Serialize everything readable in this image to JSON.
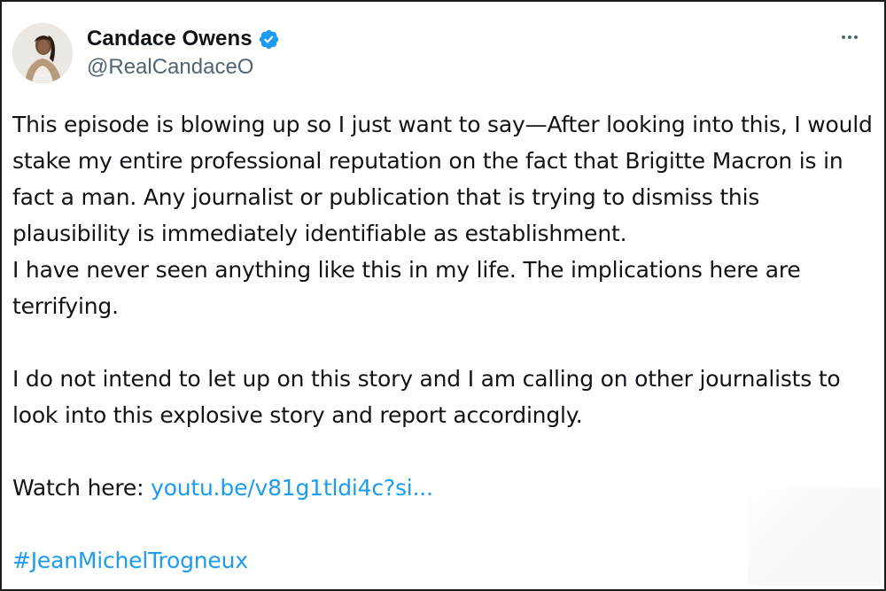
{
  "tweet": {
    "author": {
      "display_name": "Candace Owens",
      "handle": "@RealCandaceO",
      "verified": true
    },
    "more_icon": "more-horizontal-icon",
    "body": {
      "paragraph_1": "This episode is blowing up so I just want to say—After looking into this, I would stake my entire professional reputation on the fact that Brigitte Macron is in fact a man. Any journalist or publication that is trying to dismiss this plausibility is immediately identifiable as establishment.",
      "paragraph_2": "I have never seen anything like this in my life. The implications here are terrifying.",
      "paragraph_3": "I do not intend to let up on this story and I am calling on other journalists to look into this explosive story and report accordingly.",
      "watch_prefix": "Watch here: ",
      "watch_link": "youtu.be/v81g1tldi4c?si...",
      "hashtag": "#JeanMichelTrogneux"
    },
    "colors": {
      "link": "#1d9bf0",
      "verified_badge": "#1d9bf0",
      "text": "#0f1419",
      "secondary_text": "#536471"
    }
  }
}
